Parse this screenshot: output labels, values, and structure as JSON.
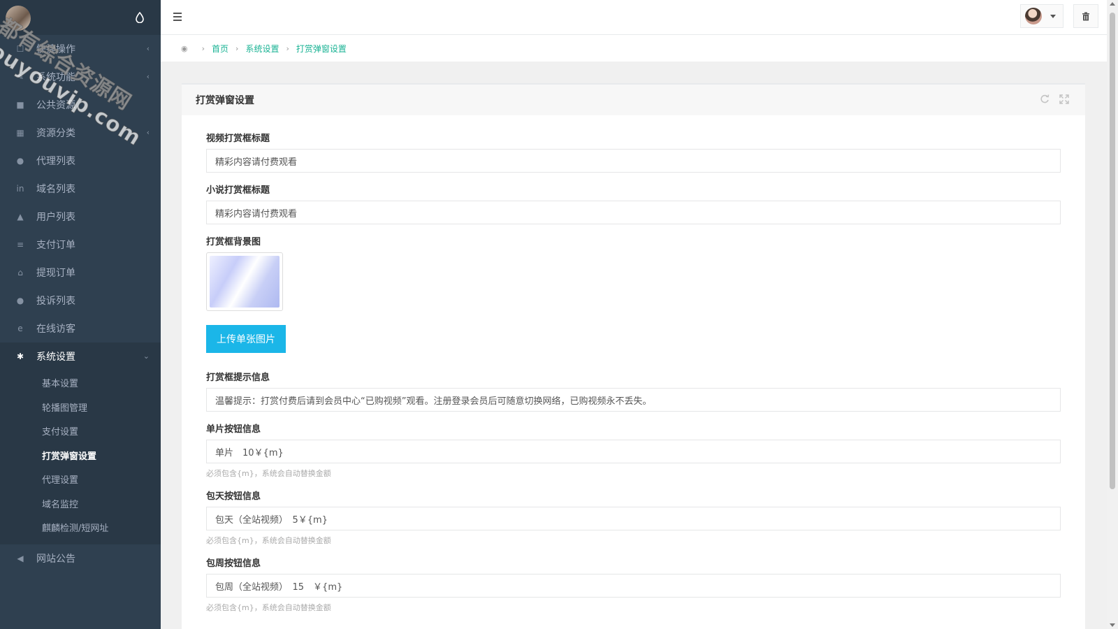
{
  "watermark": {
    "line1": "都有综合资源网",
    "line2": "douyouvip.com"
  },
  "sidebar": {
    "items": [
      {
        "label": "快捷操作",
        "icon": "shortcut-icon",
        "glyph": "☐",
        "chevron": "‹"
      },
      {
        "label": "系统功能",
        "icon": "wrench-icon",
        "glyph": "✎",
        "chevron": "‹"
      },
      {
        "label": "公共资源",
        "icon": "video-camera-icon",
        "glyph": "■",
        "chevron": ""
      },
      {
        "label": "资源分类",
        "icon": "grid-icon",
        "glyph": "▦",
        "chevron": "‹"
      },
      {
        "label": "代理列表",
        "icon": "users-icon",
        "glyph": "●",
        "chevron": ""
      },
      {
        "label": "域名列表",
        "icon": "linkedin-icon",
        "glyph": "in",
        "chevron": ""
      },
      {
        "label": "用户列表",
        "icon": "user-icon",
        "glyph": "▲",
        "chevron": ""
      },
      {
        "label": "支付订单",
        "icon": "database-icon",
        "glyph": "≡",
        "chevron": ""
      },
      {
        "label": "提现订单",
        "icon": "bank-icon",
        "glyph": "⌂",
        "chevron": ""
      },
      {
        "label": "投诉列表",
        "icon": "info-circle-icon",
        "glyph": "●",
        "chevron": ""
      },
      {
        "label": "在线访客",
        "icon": "ie-browser-icon",
        "glyph": "e",
        "chevron": ""
      },
      {
        "label": "系统设置",
        "icon": "gear-icon",
        "glyph": "✱",
        "chevron": "⌄"
      }
    ],
    "sub_items": [
      {
        "label": "基本设置"
      },
      {
        "label": "轮播图管理"
      },
      {
        "label": "支付设置"
      },
      {
        "label": "打赏弹窗设置"
      },
      {
        "label": "代理设置"
      },
      {
        "label": "域名监控"
      },
      {
        "label": "麒麟检测/短网址"
      }
    ],
    "bottom_item": {
      "label": "网站公告",
      "icon": "bullhorn-icon",
      "glyph": "◀"
    }
  },
  "breadcrumb": {
    "home": "首页",
    "section": "系统设置",
    "current": "打赏弹窗设置"
  },
  "panel": {
    "title": "打赏弹窗设置",
    "fields": {
      "video_title": {
        "label": "视频打赏框标题",
        "value": "精彩内容请付费观看"
      },
      "novel_title": {
        "label": "小说打赏框标题",
        "value": "精彩内容请付费观看"
      },
      "bg_image": {
        "label": "打赏框背景图"
      },
      "upload_button": "上传单张图片",
      "tip": {
        "label": "打赏框提示信息",
        "value": "温馨提示：打赏付费后请到会员中心“已购视频”观看。注册登录会员后可随意切换网络，已购视频永不丢失。"
      },
      "single": {
        "label": "单片按钮信息",
        "value": "单片　10￥{m}",
        "help": "必须包含{m}，系统会自动替换金额"
      },
      "daily": {
        "label": "包天按钮信息",
        "value": "包天（全站视频）　5￥{m}",
        "help": "必须包含{m}，系统会自动替换金额"
      },
      "weekly": {
        "label": "包周按钮信息",
        "value": "包周（全站视频）　15　￥{m}",
        "help": "必须包含{m}，系统会自动替换金额"
      }
    }
  },
  "colors": {
    "sidebar_bg": "#2f4050",
    "accent_green": "#1ab394",
    "upload_blue": "#1bb6e8"
  }
}
